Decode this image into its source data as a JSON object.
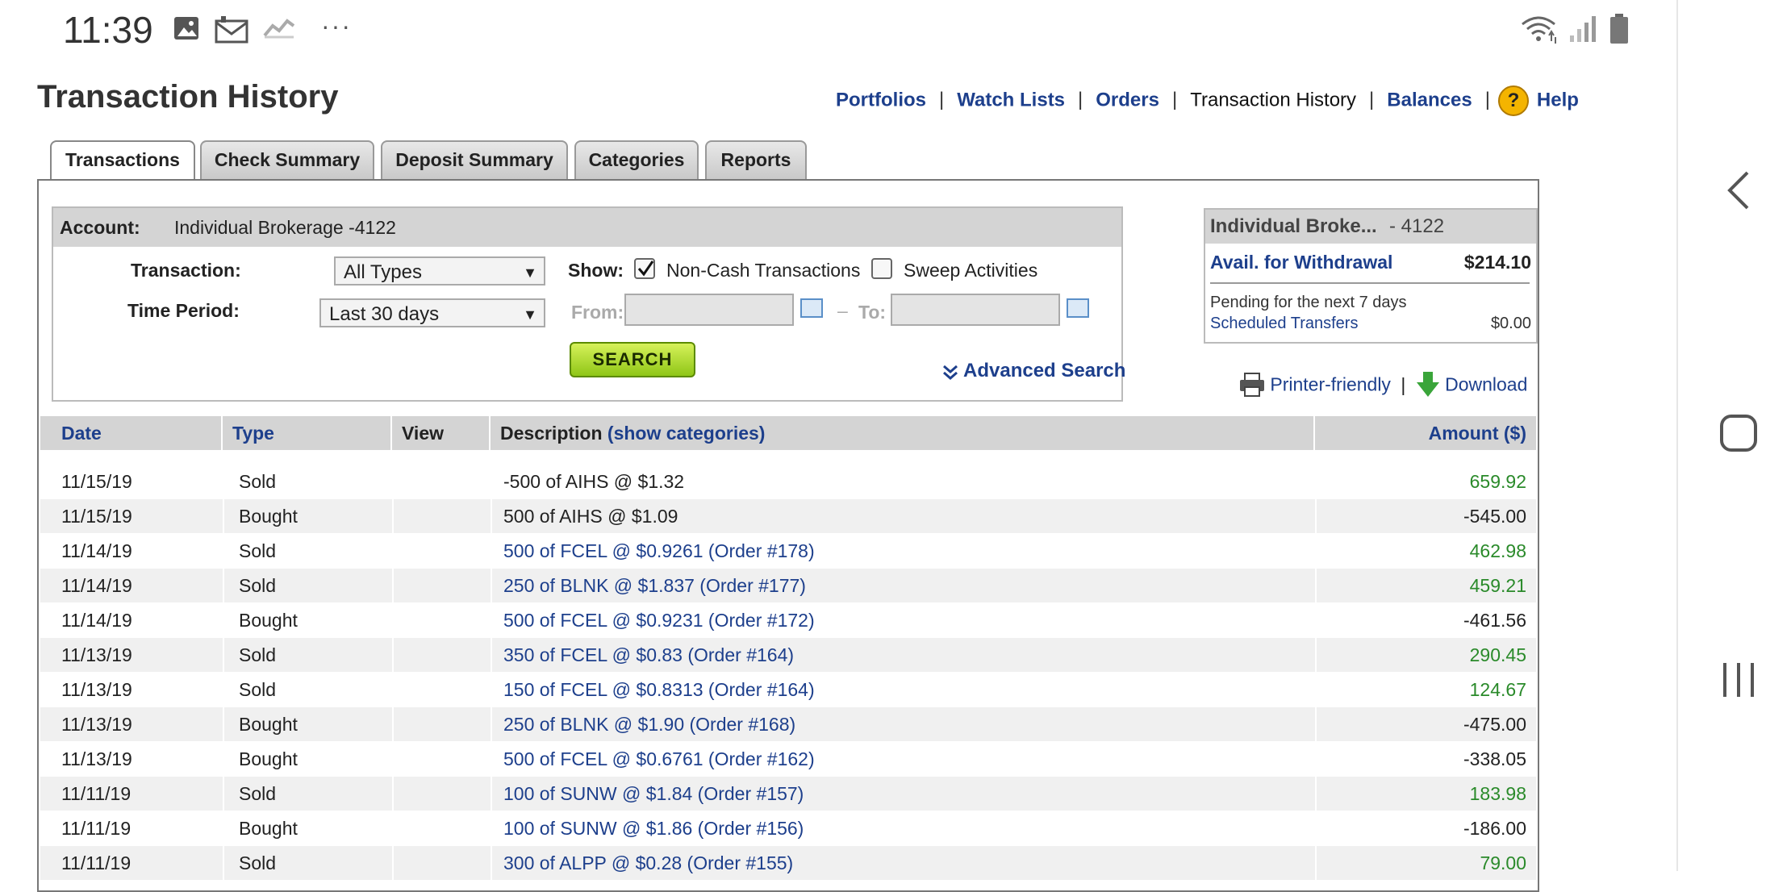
{
  "status_bar": {
    "time": "11:39",
    "icons": [
      "gallery-icon",
      "mail-icon",
      "chart-icon",
      "more-icon",
      "wifi-icon",
      "signal-icon",
      "battery-icon"
    ],
    "more": "···"
  },
  "header": {
    "title": "Transaction History",
    "nav": {
      "portfolios": "Portfolios",
      "watch_lists": "Watch Lists",
      "orders": "Orders",
      "transaction_history": "Transaction History",
      "balances": "Balances",
      "help": "Help",
      "separator": "|",
      "help_glyph": "?"
    }
  },
  "tabs": [
    {
      "label": "Transactions",
      "active": true
    },
    {
      "label": "Check Summary",
      "active": false
    },
    {
      "label": "Deposit Summary",
      "active": false
    },
    {
      "label": "Categories",
      "active": false
    },
    {
      "label": "Reports",
      "active": false
    }
  ],
  "filters": {
    "account_label": "Account:",
    "account_value": "Individual Brokerage -4122",
    "transaction_label": "Transaction:",
    "transaction_value": "All Types",
    "show_label": "Show:",
    "noncash_label": "Non-Cash Transactions",
    "noncash_checked": true,
    "sweep_label": "Sweep Activities",
    "sweep_checked": false,
    "time_period_label": "Time Period:",
    "time_period_value": "Last 30 days",
    "from_label": "From:",
    "to_label": "To:",
    "dash": "–",
    "search_label": "SEARCH",
    "advanced_search": "Advanced Search"
  },
  "summary": {
    "account_name": "Individual Broke...",
    "account_suffix": "- 4122",
    "avail_label": "Avail. for Withdrawal",
    "avail_value": "$214.10",
    "pending_label": "Pending for the next 7 days",
    "scheduled_label": "Scheduled Transfers",
    "scheduled_value": "$0.00"
  },
  "actions": {
    "printer_friendly": "Printer-friendly",
    "download": "Download",
    "separator": "|"
  },
  "table": {
    "headers": {
      "date": "Date",
      "type": "Type",
      "view": "View",
      "description": "Description",
      "show_categories": "(show categories)",
      "amount": "Amount ($)"
    },
    "rows": [
      {
        "date": "11/15/19",
        "type": "Sold",
        "description": "-500 of AIHS @ $1.32",
        "amount": "659.92",
        "link": false,
        "positive": true
      },
      {
        "date": "11/15/19",
        "type": "Bought",
        "description": "500 of AIHS @ $1.09",
        "amount": "-545.00",
        "link": false,
        "positive": false
      },
      {
        "date": "11/14/19",
        "type": "Sold",
        "description": "500 of FCEL @ $0.9261 (Order #178)",
        "amount": "462.98",
        "link": true,
        "positive": true
      },
      {
        "date": "11/14/19",
        "type": "Sold",
        "description": "250 of BLNK @ $1.837 (Order #177)",
        "amount": "459.21",
        "link": true,
        "positive": true
      },
      {
        "date": "11/14/19",
        "type": "Bought",
        "description": "500 of FCEL @ $0.9231 (Order #172)",
        "amount": "-461.56",
        "link": true,
        "positive": false
      },
      {
        "date": "11/13/19",
        "type": "Sold",
        "description": "350 of FCEL @ $0.83 (Order #164)",
        "amount": "290.45",
        "link": true,
        "positive": true
      },
      {
        "date": "11/13/19",
        "type": "Sold",
        "description": "150 of FCEL @ $0.8313 (Order #164)",
        "amount": "124.67",
        "link": true,
        "positive": true
      },
      {
        "date": "11/13/19",
        "type": "Bought",
        "description": "250 of BLNK @ $1.90 (Order #168)",
        "amount": "-475.00",
        "link": true,
        "positive": false
      },
      {
        "date": "11/13/19",
        "type": "Bought",
        "description": "500 of FCEL @ $0.6761 (Order #162)",
        "amount": "-338.05",
        "link": true,
        "positive": false
      },
      {
        "date": "11/11/19",
        "type": "Sold",
        "description": "100 of SUNW @ $1.84 (Order #157)",
        "amount": "183.98",
        "link": true,
        "positive": true
      },
      {
        "date": "11/11/19",
        "type": "Bought",
        "description": "100 of SUNW @ $1.86 (Order #156)",
        "amount": "-186.00",
        "link": true,
        "positive": false
      },
      {
        "date": "11/11/19",
        "type": "Sold",
        "description": "300 of ALPP @ $0.28 (Order #155)",
        "amount": "79.00",
        "link": true,
        "positive": true
      }
    ]
  },
  "colors": {
    "link": "#1d3f8c",
    "positive": "#2a8a2a",
    "header_bg": "#d4d4d4",
    "search_button": "#a6d62a"
  }
}
